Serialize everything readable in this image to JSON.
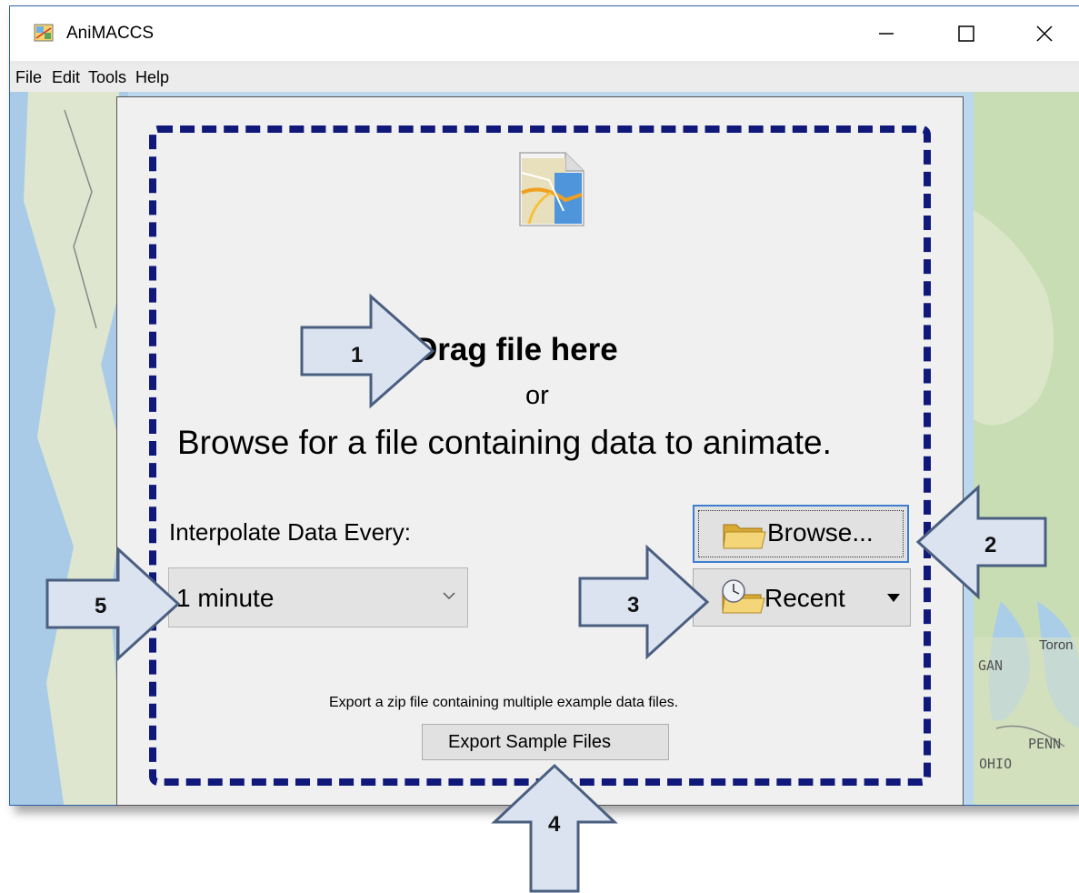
{
  "window": {
    "title": "AniMACCS"
  },
  "menu": {
    "items": [
      "File",
      "Edit",
      "Tools",
      "Help"
    ]
  },
  "map_labels": {
    "gan": "GAN",
    "toron": "Toron",
    "ohio": "OHIO",
    "penn": "PENN"
  },
  "dropzone": {
    "heading": "Drag file here",
    "or": "or",
    "description": "Browse for a file containing data to animate."
  },
  "interpolate": {
    "label": "Interpolate Data Every:",
    "value": "1 minute"
  },
  "buttons": {
    "browse": "Browse...",
    "recent": "Recent",
    "export": "Export Sample Files"
  },
  "export": {
    "description": "Export a zip file containing multiple example data files."
  },
  "callouts": [
    "1",
    "2",
    "3",
    "4",
    "5"
  ],
  "colors": {
    "dash_border": "#10197a",
    "callout_fill": "#dbe3f1",
    "callout_stroke": "#4a5f80"
  }
}
